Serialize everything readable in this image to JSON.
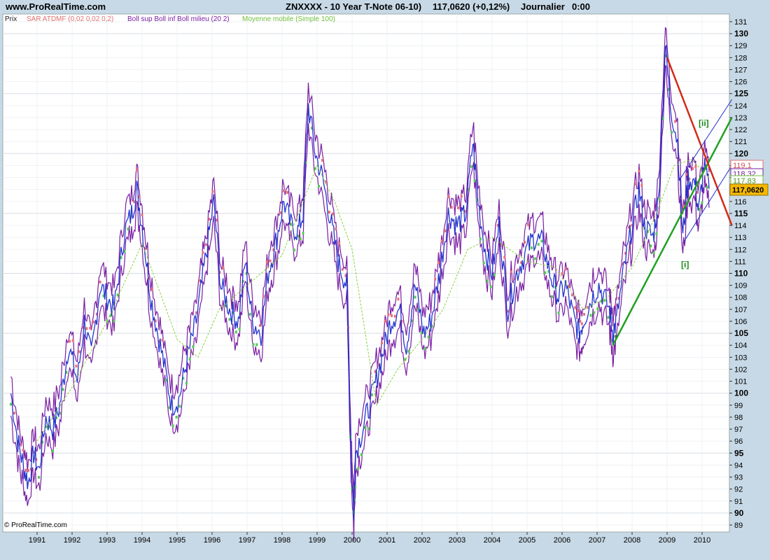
{
  "header": {
    "site": "www.ProRealTime.com",
    "title": "ZNXXXX - 10 Year T-Note 06-10)",
    "quote": "117,0620 (+0,12%)",
    "period": "Journalier",
    "time": "0:00"
  },
  "legend": [
    {
      "label": "Prix",
      "color": "#222222"
    },
    {
      "label": "SAR ATDMF (0,02 0,02 0,2)",
      "color": "#e07070"
    },
    {
      "label": "Boll sup Boll inf Boll milieu (20 2)",
      "color": "#7a1fa2"
    },
    {
      "label": "Moyenne mobile (Simple 100)",
      "color": "#6fbf3a"
    }
  ],
  "copyright": "© ProRealTime.com",
  "price_labels": {
    "sar": "119,1",
    "boll_sup": "118,32",
    "boll_mid": "117,83",
    "last": "117,0620"
  },
  "annotations": {
    "wave_i": "[i]",
    "wave_ii": "[ii]"
  },
  "colors": {
    "background": "#ffffff",
    "frame": "#c7d9e6",
    "price": "#2233cc",
    "sar": "#e8707a",
    "bollinger": "#7a1fa2",
    "ma": "#8cd13a",
    "support": "#22a022",
    "resistance": "#d42a1a",
    "channel": "#2233cc",
    "last_price_bg": "#f5b800"
  },
  "chart_data": {
    "type": "line",
    "title": "ZNXXXX - 10 Year T-Note 06-10)",
    "scale": "linear",
    "ylim": [
      89,
      132
    ],
    "xlim": [
      1990.25,
      2010.9
    ],
    "grid": true,
    "y_ticks": [
      89,
      90,
      91,
      92,
      93,
      94,
      95,
      96,
      97,
      98,
      99,
      100,
      101,
      102,
      103,
      104,
      105,
      106,
      107,
      108,
      109,
      110,
      111,
      112,
      113,
      114,
      115,
      116,
      117,
      118,
      119,
      120,
      121,
      122,
      123,
      124,
      125,
      126,
      127,
      128,
      129,
      130,
      131
    ],
    "y_major_ticks": [
      90,
      95,
      100,
      105,
      110,
      115,
      120,
      125,
      130
    ],
    "x_ticks": [
      {
        "label": "1991",
        "x": 1991
      },
      {
        "label": "1992",
        "x": 1992
      },
      {
        "label": "1993",
        "x": 1993
      },
      {
        "label": "1994",
        "x": 1994
      },
      {
        "label": "1995",
        "x": 1995
      },
      {
        "label": "1996",
        "x": 1996
      },
      {
        "label": "1997",
        "x": 1997
      },
      {
        "label": "1998",
        "x": 1998
      },
      {
        "label": "1999",
        "x": 1999
      },
      {
        "label": "2000",
        "x": 2000
      },
      {
        "label": "2001",
        "x": 2001
      },
      {
        "label": "2002",
        "x": 2002
      },
      {
        "label": "2003",
        "x": 2003
      },
      {
        "label": "2004",
        "x": 2004
      },
      {
        "label": "2005",
        "x": 2005
      },
      {
        "label": "2006",
        "x": 2006
      },
      {
        "label": "2007",
        "x": 2007
      },
      {
        "label": "2008",
        "x": 2008
      },
      {
        "label": "2009",
        "x": 2009
      },
      {
        "label": "2010",
        "x": 2010
      }
    ],
    "series": [
      {
        "name": "Prix",
        "points": [
          [
            1990.25,
            100
          ],
          [
            1990.45,
            96
          ],
          [
            1990.6,
            94
          ],
          [
            1990.75,
            92.5
          ],
          [
            1990.9,
            95
          ],
          [
            1991.05,
            93.5
          ],
          [
            1991.25,
            98
          ],
          [
            1991.45,
            97
          ],
          [
            1991.65,
            99
          ],
          [
            1991.9,
            104
          ],
          [
            1992.15,
            101
          ],
          [
            1992.35,
            106
          ],
          [
            1992.55,
            103
          ],
          [
            1992.8,
            109
          ],
          [
            1993.0,
            108
          ],
          [
            1993.2,
            107
          ],
          [
            1993.5,
            113.5
          ],
          [
            1993.7,
            115
          ],
          [
            1993.85,
            117
          ],
          [
            1994.0,
            114
          ],
          [
            1994.25,
            108
          ],
          [
            1994.45,
            105
          ],
          [
            1994.65,
            102
          ],
          [
            1994.85,
            99
          ],
          [
            1995.05,
            99.5
          ],
          [
            1995.3,
            103
          ],
          [
            1995.55,
            106
          ],
          [
            1995.8,
            111
          ],
          [
            1996.05,
            116
          ],
          [
            1996.25,
            109
          ],
          [
            1996.5,
            107
          ],
          [
            1996.75,
            106
          ],
          [
            1996.95,
            111
          ],
          [
            1997.15,
            106
          ],
          [
            1997.4,
            105
          ],
          [
            1997.6,
            110
          ],
          [
            1997.85,
            113
          ],
          [
            1998.05,
            116
          ],
          [
            1998.25,
            114
          ],
          [
            1998.45,
            113.5
          ],
          [
            1998.6,
            115
          ],
          [
            1998.75,
            124
          ],
          [
            1998.95,
            120
          ],
          [
            1999.15,
            118
          ],
          [
            1999.35,
            115
          ],
          [
            1999.6,
            111
          ],
          [
            1999.85,
            109
          ],
          [
            1999.97,
            95
          ],
          [
            2000.05,
            90
          ],
          [
            2000.1,
            95
          ],
          [
            2000.3,
            97
          ],
          [
            2000.6,
            100
          ],
          [
            2000.85,
            103
          ],
          [
            2001.1,
            106
          ],
          [
            2001.35,
            107
          ],
          [
            2001.55,
            104
          ],
          [
            2001.8,
            109
          ],
          [
            2002.05,
            105
          ],
          [
            2002.25,
            106
          ],
          [
            2002.5,
            110
          ],
          [
            2002.75,
            115
          ],
          [
            2003.0,
            114
          ],
          [
            2003.25,
            115
          ],
          [
            2003.45,
            121
          ],
          [
            2003.6,
            116
          ],
          [
            2003.8,
            112
          ],
          [
            2004.0,
            110
          ],
          [
            2004.2,
            114
          ],
          [
            2004.45,
            107
          ],
          [
            2004.7,
            110
          ],
          [
            2005.0,
            112
          ],
          [
            2005.2,
            113
          ],
          [
            2005.45,
            112.5
          ],
          [
            2005.65,
            110
          ],
          [
            2005.9,
            108
          ],
          [
            2006.1,
            109
          ],
          [
            2006.35,
            106
          ],
          [
            2006.5,
            105
          ],
          [
            2006.6,
            106
          ],
          [
            2006.85,
            108
          ],
          [
            2007.05,
            109
          ],
          [
            2007.35,
            107
          ],
          [
            2007.45,
            105
          ],
          [
            2007.55,
            106
          ],
          [
            2007.75,
            110
          ],
          [
            2008.0,
            114
          ],
          [
            2008.2,
            117
          ],
          [
            2008.35,
            114
          ],
          [
            2008.6,
            113
          ],
          [
            2008.75,
            116
          ],
          [
            2008.95,
            129
          ],
          [
            2009.1,
            124
          ],
          [
            2009.3,
            121
          ],
          [
            2009.45,
            113
          ],
          [
            2009.6,
            118
          ],
          [
            2009.8,
            117.5
          ],
          [
            2009.9,
            115
          ],
          [
            2010.05,
            119
          ],
          [
            2010.2,
            117.06
          ]
        ]
      },
      {
        "name": "Moyenne mobile (Simple 100)",
        "points": [
          [
            1991.0,
            96
          ],
          [
            1992.0,
            100.5
          ],
          [
            1993.0,
            106
          ],
          [
            1994.0,
            112.5
          ],
          [
            1995.0,
            104.5
          ],
          [
            1995.6,
            103
          ],
          [
            1996.2,
            107
          ],
          [
            1997.0,
            109
          ],
          [
            1998.0,
            111.5
          ],
          [
            1999.0,
            119
          ],
          [
            1999.5,
            116
          ],
          [
            2000.0,
            112
          ],
          [
            2000.7,
            99
          ],
          [
            2001.3,
            102
          ],
          [
            2002.0,
            104.5
          ],
          [
            2002.6,
            107
          ],
          [
            2003.3,
            112
          ],
          [
            2004.0,
            113
          ],
          [
            2005.0,
            111
          ],
          [
            2005.8,
            110.5
          ],
          [
            2006.6,
            107
          ],
          [
            2007.3,
            108
          ],
          [
            2008.0,
            110.5
          ],
          [
            2008.7,
            115
          ],
          [
            2009.2,
            119
          ],
          [
            2009.7,
            119.5
          ],
          [
            2010.2,
            118
          ]
        ]
      }
    ],
    "trendlines": [
      {
        "name": "support",
        "from": [
          2007.45,
          104
        ],
        "to": [
          2010.85,
          123
        ]
      },
      {
        "name": "resistance",
        "from": [
          2009.0,
          128
        ],
        "to": [
          2010.85,
          114
        ]
      },
      {
        "name": "channel_upper",
        "from": [
          2009.4,
          118
        ],
        "to": [
          2010.85,
          124.5
        ]
      },
      {
        "name": "channel_lower",
        "from": [
          2009.45,
          112.5
        ],
        "to": [
          2010.85,
          119
        ]
      }
    ],
    "wave_labels": [
      {
        "text": "[i]",
        "x": 2009.4,
        "y": 110.5
      },
      {
        "text": "[ii]",
        "x": 2009.9,
        "y": 122.3
      }
    ]
  }
}
